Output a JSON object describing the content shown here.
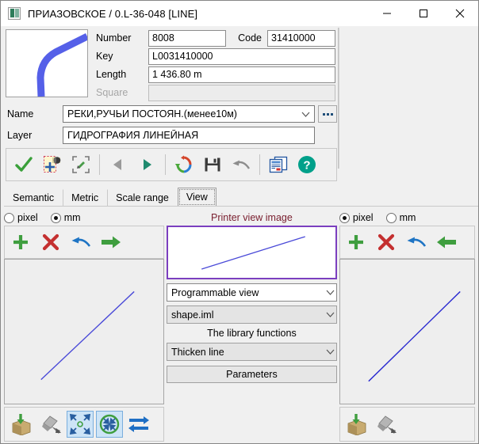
{
  "window": {
    "title": "ПРИАЗОВСКОЕ / 0.L-36-048 [LINE]",
    "app_icon": "map-object-icon",
    "minimize_label": "—",
    "maximize_label": "□",
    "close_label": "✕"
  },
  "object": {
    "thumbnail_name": "river-curve-thumbnail",
    "fields": {
      "number_label": "Number",
      "number_value": "8008",
      "code_label": "Code",
      "code_value": "31410000",
      "key_label": "Key",
      "key_value": "L0031410000",
      "length_label": "Length",
      "length_value": "1 436.80 m",
      "square_label": "Square",
      "square_value": ""
    },
    "name_label": "Name",
    "name_value": "РЕКИ,РУЧЬИ ПОСТОЯН.(менее10м)",
    "browse_label": "...",
    "layer_label": "Layer",
    "layer_value": "ГИДРОГРАФИЯ ЛИНЕЙНАЯ"
  },
  "toolbar": {
    "items": [
      {
        "name": "apply-check-icon",
        "title": "Apply"
      },
      {
        "name": "add-object-icon",
        "title": "Add object"
      },
      {
        "name": "fit-to-view-icon",
        "title": "Fit to view"
      },
      {
        "name": "previous-arrow-icon",
        "title": "Previous"
      },
      {
        "name": "next-arrow-icon",
        "title": "Next"
      },
      {
        "name": "refresh-icon",
        "title": "Refresh"
      },
      {
        "name": "save-icon",
        "title": "Save"
      },
      {
        "name": "undo-icon",
        "title": "Undo"
      },
      {
        "name": "report-icon",
        "title": "Report"
      },
      {
        "name": "help-icon",
        "title": "Help"
      }
    ]
  },
  "tabs": [
    {
      "label": "Semantic",
      "active": false
    },
    {
      "label": "Metric",
      "active": false
    },
    {
      "label": "Scale range",
      "active": false
    },
    {
      "label": "View",
      "active": true
    }
  ],
  "left_panel": {
    "units": [
      {
        "label": "pixel",
        "selected": false
      },
      {
        "label": "mm",
        "selected": true
      }
    ],
    "actions": [
      {
        "name": "add-icon",
        "title": "Add"
      },
      {
        "name": "delete-icon",
        "title": "Delete"
      },
      {
        "name": "undo-arrow-icon",
        "title": "Undo"
      },
      {
        "name": "copy-right-arrow-icon",
        "title": "Copy to right"
      }
    ],
    "preview_name": "left-view-preview",
    "bottom_actions": [
      {
        "name": "import-box-icon",
        "title": "Import",
        "selected": false
      },
      {
        "name": "eyedropper-icon",
        "title": "Pick style",
        "selected": false
      },
      {
        "name": "zoom-out-icon",
        "title": "Zoom out",
        "selected": true
      },
      {
        "name": "zoom-in-icon",
        "title": "Zoom in",
        "selected": true
      },
      {
        "name": "swap-arrows-icon",
        "title": "Swap",
        "selected": false
      }
    ]
  },
  "center_panel": {
    "title": "Printer view image",
    "preview_name": "printer-view-preview",
    "view_type_value": "Programmable view",
    "library_file_value": "shape.iml",
    "library_label": "The library functions",
    "function_value": "Thicken line",
    "parameters_label": "Parameters"
  },
  "right_panel": {
    "units": [
      {
        "label": "pixel",
        "selected": true
      },
      {
        "label": "mm",
        "selected": false
      }
    ],
    "actions": [
      {
        "name": "add-icon",
        "title": "Add"
      },
      {
        "name": "delete-icon",
        "title": "Delete"
      },
      {
        "name": "undo-arrow-icon",
        "title": "Undo"
      },
      {
        "name": "copy-left-arrow-icon",
        "title": "Copy to left"
      }
    ],
    "preview_name": "right-view-preview",
    "bottom_actions": [
      {
        "name": "import-box-icon",
        "title": "Import"
      },
      {
        "name": "eyedropper-icon",
        "title": "Pick style"
      }
    ]
  },
  "colors": {
    "line_blue": "#4a4ad8",
    "river_blue": "#5560e8",
    "printer_border": "#7b3fbf",
    "center_title": "#7a2030",
    "selection": "#cde4f7"
  }
}
